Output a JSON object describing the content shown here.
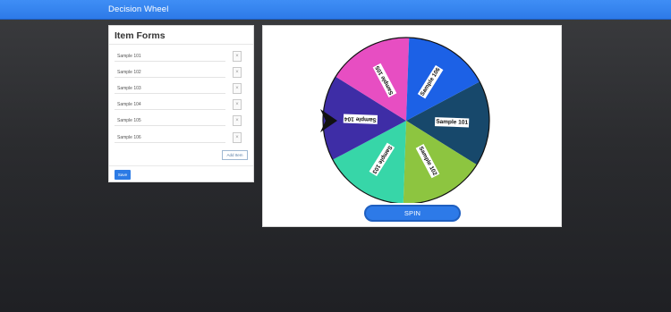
{
  "app": {
    "title": "Decision Wheel"
  },
  "form": {
    "heading": "Item Forms",
    "items": [
      {
        "value": "Sample 101"
      },
      {
        "value": "Sample 102"
      },
      {
        "value": "Sample 103"
      },
      {
        "value": "Sample 104"
      },
      {
        "value": "Sample 105"
      },
      {
        "value": "Sample 106"
      }
    ],
    "remove_label": "×",
    "add_label": "Add Item",
    "save_label": "Save"
  },
  "wheel": {
    "segments": [
      {
        "label": "Sample 101",
        "color": "#17486b"
      },
      {
        "label": "Sample 102",
        "color": "#8dc540"
      },
      {
        "label": "Sample 103",
        "color": "#37d6a8"
      },
      {
        "label": "Sample 104",
        "color": "#3e2da6"
      },
      {
        "label": "Sample 105",
        "color": "#e74ec2"
      },
      {
        "label": "Sample 106",
        "color": "#1c61e6"
      }
    ],
    "pointer_icon": "arrow-pointer-icon",
    "spin_label": "SPIN"
  },
  "colors": {
    "navbar": "#3484ee",
    "primary": "#2d7ae8",
    "background": "#2b2c2f"
  }
}
